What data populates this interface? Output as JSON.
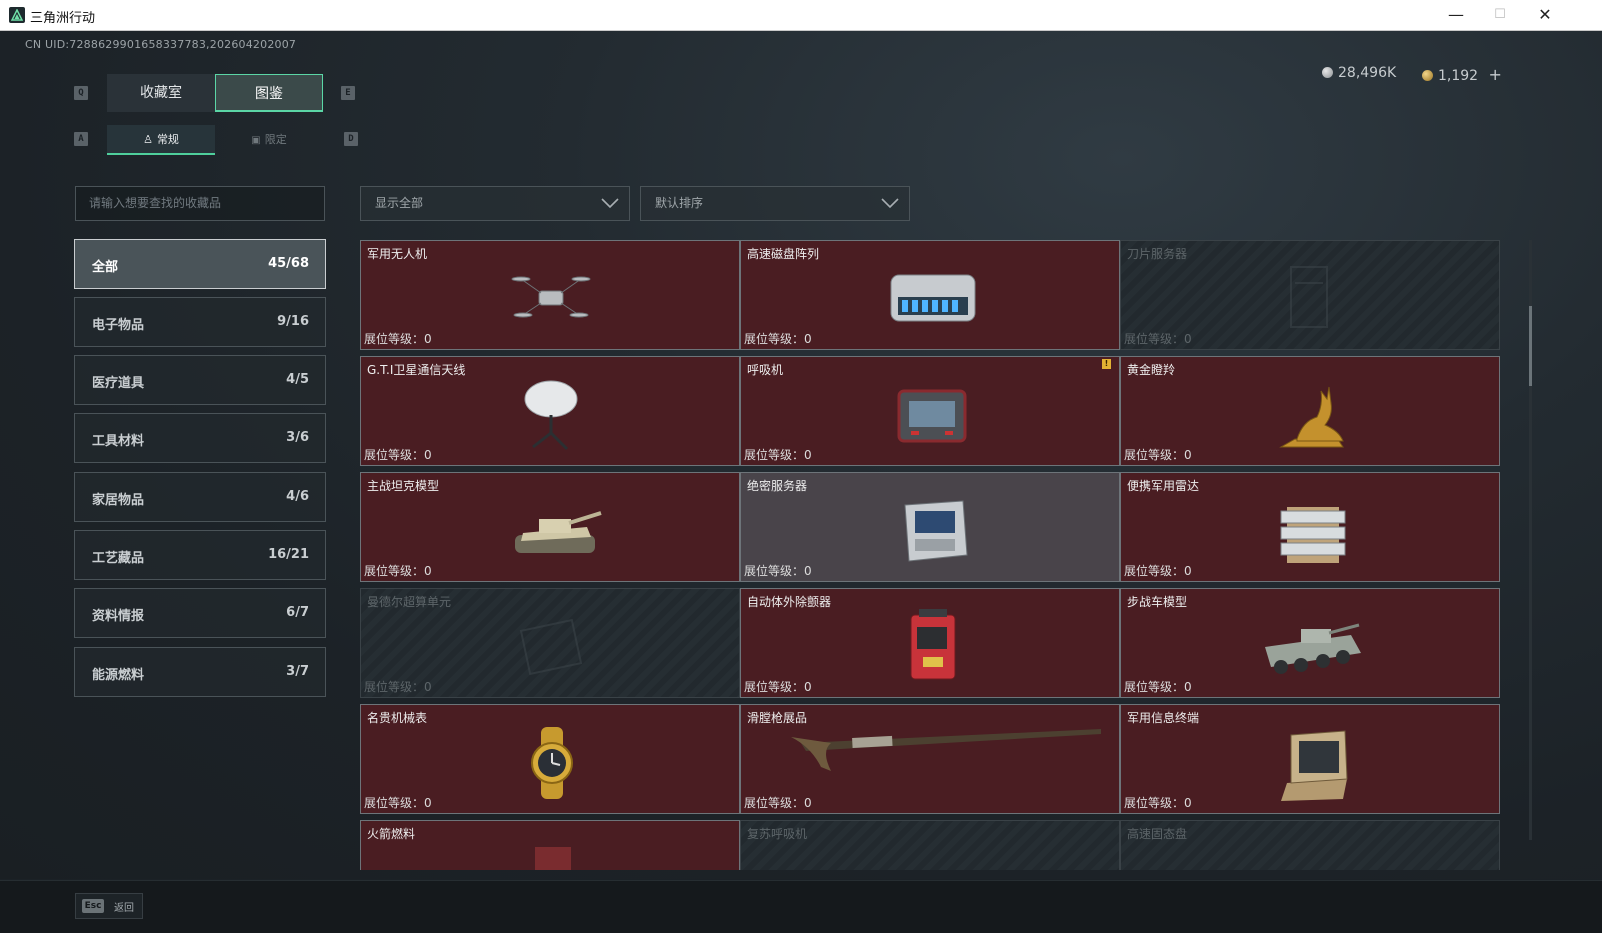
{
  "window": {
    "title": "三角洲行动",
    "minimize": "—",
    "maximize": "☐",
    "close": "✕"
  },
  "uid": "CN UID:7288629901658337783,202604202007",
  "currency": {
    "silver": "28,496K",
    "gold": "1,192",
    "plus": "+"
  },
  "keys": {
    "q": "Q",
    "e": "E",
    "a": "A",
    "d": "D"
  },
  "tabs": [
    {
      "label": "收藏室"
    },
    {
      "label": "图鉴"
    }
  ],
  "subtabs": [
    {
      "label": "常规"
    },
    {
      "label": "限定"
    }
  ],
  "search": {
    "placeholder": "请输入想要查找的收藏品"
  },
  "filters": {
    "display": "显示全部",
    "sort": "默认排序"
  },
  "categories": [
    {
      "label": "全部",
      "count": "45/68"
    },
    {
      "label": "电子物品",
      "count": "9/16"
    },
    {
      "label": "医疗道具",
      "count": "4/5"
    },
    {
      "label": "工具材料",
      "count": "3/6"
    },
    {
      "label": "家居物品",
      "count": "4/6"
    },
    {
      "label": "工艺藏品",
      "count": "16/21"
    },
    {
      "label": "资料情报",
      "count": "6/7"
    },
    {
      "label": "能源燃料",
      "count": "3/7"
    }
  ],
  "level_label": "展位等级：",
  "level_value": "0",
  "items": [
    {
      "name": "军用无人机",
      "state": "owned",
      "icon": "drone-icon"
    },
    {
      "name": "高速磁盘阵列",
      "state": "owned",
      "icon": "disk-array-icon"
    },
    {
      "name": "刀片服务器",
      "state": "locked",
      "icon": "blade-server-icon"
    },
    {
      "name": "G.T.I卫星通信天线",
      "state": "owned",
      "icon": "satellite-dish-icon"
    },
    {
      "name": "呼吸机",
      "state": "owned",
      "icon": "ventilator-icon",
      "badge": "!"
    },
    {
      "name": "黄金瞪羚",
      "state": "owned",
      "icon": "golden-gazelle-icon"
    },
    {
      "name": "主战坦克模型",
      "state": "owned",
      "icon": "tank-model-icon"
    },
    {
      "name": "绝密服务器",
      "state": "gray",
      "icon": "secret-server-icon"
    },
    {
      "name": "便携军用雷达",
      "state": "owned",
      "icon": "portable-radar-icon"
    },
    {
      "name": "曼德尔超算单元",
      "state": "locked",
      "icon": "supercomputer-unit-icon"
    },
    {
      "name": "自动体外除颤器",
      "state": "owned",
      "icon": "defibrillator-icon"
    },
    {
      "name": "步战车模型",
      "state": "owned",
      "icon": "ifv-model-icon"
    },
    {
      "name": "名贵机械表",
      "state": "owned",
      "icon": "watch-icon"
    },
    {
      "name": "滑膛枪展品",
      "state": "owned",
      "icon": "musket-icon"
    },
    {
      "name": "军用信息终端",
      "state": "owned",
      "icon": "terminal-icon"
    },
    {
      "name": "火箭燃料",
      "state": "owned",
      "icon": "rocket-fuel-icon"
    },
    {
      "name": "复苏呼吸机",
      "state": "locked",
      "icon": "resuscitator-icon"
    },
    {
      "name": "高速固态盘",
      "state": "locked",
      "icon": "ssd-icon"
    }
  ],
  "footer": {
    "esc_key": "Esc",
    "back": "返回"
  }
}
